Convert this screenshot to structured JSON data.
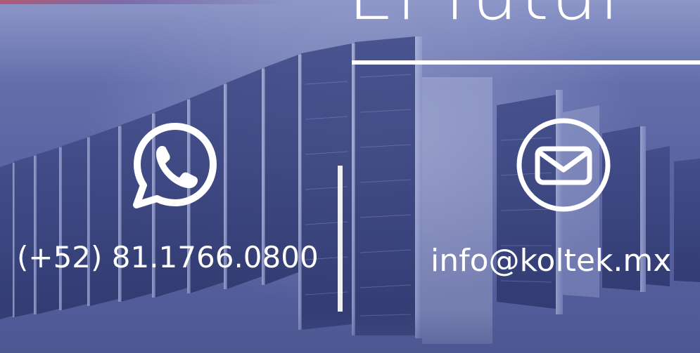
{
  "banner": {
    "headline": "El futur",
    "contact": {
      "phone": "(+52) 81.1766.0800",
      "email": "info@koltek.mx"
    },
    "icons": {
      "phone": "whatsapp-icon",
      "email": "mail-icon"
    }
  },
  "colors": {
    "overlay": "#5b65a3",
    "text": "#ffffff"
  }
}
